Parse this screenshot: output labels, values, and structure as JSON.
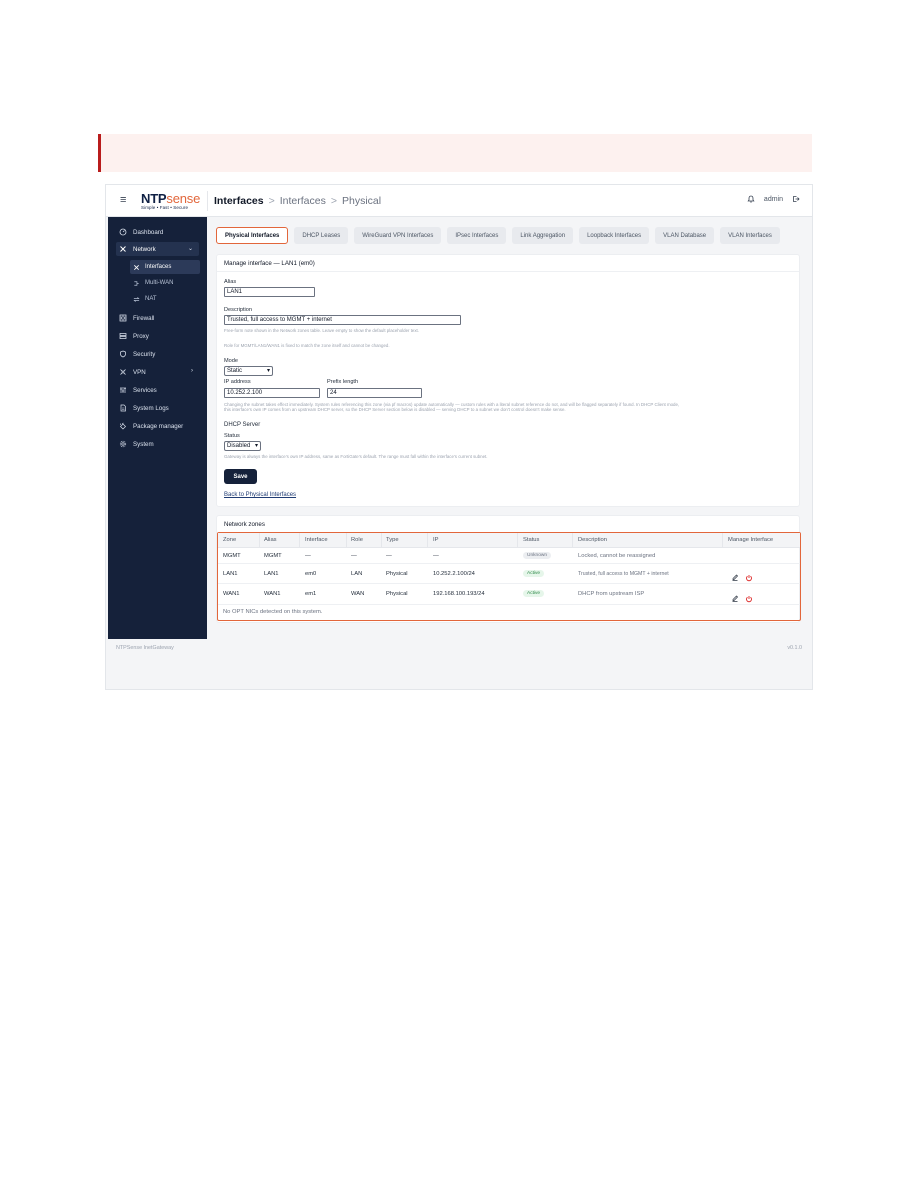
{
  "header": {
    "brand_primary": "NTP",
    "brand_secondary": "sense",
    "brand_tagline": "Simple • Fast • Secure",
    "breadcrumb": [
      "Interfaces",
      "Interfaces",
      "Physical"
    ],
    "user": "admin"
  },
  "sidebar": {
    "items": [
      {
        "label": "Dashboard",
        "icon": "dashboard-icon"
      },
      {
        "label": "Network",
        "icon": "network-icon"
      },
      {
        "label": "Interfaces",
        "icon": "interfaces-icon"
      },
      {
        "label": "Multi-WAN",
        "icon": "multiwan-icon"
      },
      {
        "label": "NAT",
        "icon": "nat-icon"
      },
      {
        "label": "Firewall",
        "icon": "firewall-icon"
      },
      {
        "label": "Proxy",
        "icon": "proxy-icon"
      },
      {
        "label": "Security",
        "icon": "shield-icon"
      },
      {
        "label": "VPN",
        "icon": "vpn-icon"
      },
      {
        "label": "Services",
        "icon": "services-icon"
      },
      {
        "label": "System Logs",
        "icon": "logs-icon"
      },
      {
        "label": "Package manager",
        "icon": "package-icon"
      },
      {
        "label": "System",
        "icon": "gear-icon"
      }
    ]
  },
  "tabs": [
    "Physical Interfaces",
    "DHCP Leases",
    "WireGuard VPN Interfaces",
    "IPsec Interfaces",
    "Link Aggregation",
    "Loopback Interfaces",
    "VLAN Database",
    "VLAN Interfaces"
  ],
  "form": {
    "title": "Manage interface — LAN1 (em0)",
    "alias_label": "Alias",
    "alias_value": "LAN1",
    "description_label": "Description",
    "description_value": "Trusted, full access to MGMT + internet",
    "description_help": "Free-form note shown in the Network zones table. Leave empty to show the default placeholder text.",
    "role_help": "Role for MGMT/LAN1/WAN1 is fixed to match the zone itself and cannot be changed.",
    "mode_label": "Mode",
    "mode_value": "Static",
    "ip_label": "IP address",
    "ip_value": "10.252.2.100",
    "prefix_label": "Prefix length",
    "prefix_value": "24",
    "subnet_help_1": "Changing the subnet takes effect immediately. System rules referencing this zone (via pf macros) update automatically — custom rules with a literal subnet reference do not, and will be flagged separately if found. In DHCP Client mode,",
    "subnet_help_2": "this interface's own IP comes from an upstream DHCP server, so the DHCP Server section below is disabled — serving DHCP to a subnet we don't control doesn't make sense.",
    "dhcp_heading": "DHCP Server",
    "status_label": "Status",
    "status_value": "Disabled",
    "gateway_help": "Gateway is always the interface's own IP address, same as FortiGate's default. The range must fall within the interface's current subnet.",
    "save_label": "Save",
    "back_label": "Back to Physical Interfaces"
  },
  "zones": {
    "title": "Network zones",
    "columns": [
      "Zone",
      "Alias",
      "Interface",
      "Role",
      "Type",
      "IP",
      "Status",
      "Description",
      "Manage Interface"
    ],
    "rows": [
      {
        "zone": "MGMT",
        "alias": "MGMT",
        "iface": "—",
        "role": "—",
        "type": "—",
        "ip": "—",
        "status": "Unknown",
        "desc": "Locked, cannot be reassigned"
      },
      {
        "zone": "LAN1",
        "alias": "LAN1",
        "iface": "em0",
        "role": "LAN",
        "type": "Physical",
        "ip": "10.252.2.100/24",
        "status": "Active",
        "desc": "Trusted, full access to MGMT + internet"
      },
      {
        "zone": "WAN1",
        "alias": "WAN1",
        "iface": "em1",
        "role": "WAN",
        "type": "Physical",
        "ip": "192.168.100.193/24",
        "status": "Active",
        "desc": "DHCP from upstream ISP"
      }
    ],
    "footer_note": "No OPT NICs detected on this system."
  },
  "footer": {
    "left": "NTPSense InetGateway",
    "right": "v0.1.0"
  },
  "colors": {
    "accent": "#e2663b",
    "sidebar_bg": "#15213a",
    "alert_border": "#b91c1c"
  }
}
